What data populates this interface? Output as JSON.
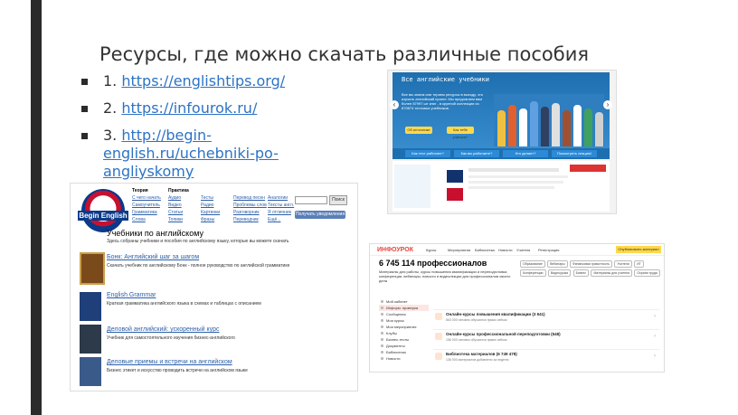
{
  "slide": {
    "title": "Ресурсы, где можно скачать различные пособия",
    "links": [
      {
        "num": "1.",
        "url": "https://englishtips.org/"
      },
      {
        "num": "2.",
        "url": "https://infourok.ru/"
      },
      {
        "num": "3.",
        "url": "http://begin-english.ru/uchebniki-po-angliyskomy"
      }
    ]
  },
  "begin_english": {
    "logo_text": "Begin English",
    "menu": [
      {
        "head": "Теория",
        "items": [
          "С чего начать",
          "Самоучитель",
          "Грамматика",
          "Слова"
        ]
      },
      {
        "head": "Практика",
        "items": [
          "Аудио",
          "Видео",
          "Статьи",
          "Топики"
        ]
      },
      {
        "head": "",
        "items": [
          "Тесты",
          "Радио",
          "Картинки",
          "Фразы"
        ]
      },
      {
        "head": "",
        "items": [
          "Перевод песен",
          "Проблемы слов",
          "Разговорник",
          "Переводчик"
        ]
      },
      {
        "head": "",
        "items": [
          "Аналогии",
          "Тексты англ.",
          "Я отличник",
          "Ещё..."
        ]
      }
    ],
    "search_button": "Поиск",
    "notify_button": "Получать уведомления",
    "page_heading": "Учебники по английскому",
    "page_sub": "Здесь собраны учебники и пособия по английскому языку, которые вы можете скачать",
    "books": [
      {
        "title": "Бонк: Английский шаг за шагом",
        "desc": "Скачать учебник по английскому Бонк - полное руководство по английской грамматике",
        "color": "#7a4a1a"
      },
      {
        "title": "English Grammar",
        "desc": "Краткая грамматика английского языка в схемах и таблицах с описанием",
        "color": "#1e3f7a"
      },
      {
        "title": "Деловой английский: ускоренный курс",
        "desc": "Учебник для самостоятельного изучения бизнес-английского",
        "color": "#2c3a4a"
      },
      {
        "title": "Деловые приемы и встречи на английском",
        "desc": "Бизнес этикет и искусство проводить встречи на английском языке",
        "color": "#3a5a8a"
      }
    ]
  },
  "infourok_banner": {
    "title": "Все английские учебники",
    "text": "Все вы знаем или теряем ресурсы в выходу, что изучить английский проект. Мы предлагаем вам более 87997 шт книг - в крупной коллекции из 870874 тестовых учебников.",
    "buttons": [
      "Об источнике",
      "Как тебе учиться?"
    ],
    "tabs": [
      "Как тест работает?",
      "Как вы работаете?",
      "Кто делает?",
      "Посмотреть лекцию!"
    ],
    "arrow_left": "‹",
    "arrow_right": "›"
  },
  "infourok_main": {
    "logo": "ИНФОУРОК",
    "nav": [
      "Курсы",
      "Мероприятия",
      "Библиотека",
      "Новости",
      "Учителя",
      "Регистрация"
    ],
    "cta": "Опубликовать материал",
    "big_number": "6 745 114 профессионалов",
    "lead": "Материалы для работы, курсы повышения квалификации и переподготовки, конференции, вебинары, новости и видеолекции для профессионалов своего дела",
    "tags": [
      "Образование",
      "Вебинары",
      "Финансовая грамотность",
      "Учителя",
      "ИТ",
      "Конференции",
      "Видеоуроки",
      "Бизнес",
      "Материалы для учителя",
      "Охрана труда"
    ],
    "sidebar": [
      "Мой кабинет",
      "Информ. проверка",
      "Сообщения",
      "Мои курсы",
      "Мои мероприятия",
      "Клубы",
      "Бизнес-тесты",
      "Документы",
      "Библиотека",
      "Новости"
    ],
    "features": [
      {
        "title": "Онлайн-курсы повышения квалификации (3 641)",
        "sub": "863 000 человек обучаются прямо сейчас"
      },
      {
        "title": "Онлайн-курсы профессиональной переподготовки (548)",
        "sub": "156 000 человек обучаются прямо сейчас"
      },
      {
        "title": "Библиотека материалов (6 749 478)",
        "sub": "136 000 материалов добавлено за неделю"
      }
    ]
  }
}
